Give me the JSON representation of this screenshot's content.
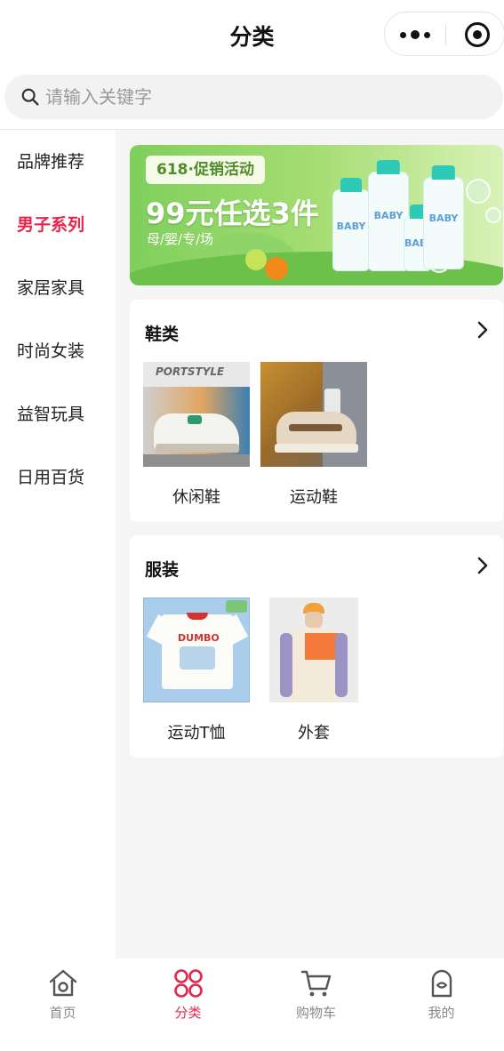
{
  "header": {
    "title": "分类"
  },
  "search": {
    "placeholder": "请输入关键字",
    "value": ""
  },
  "sidebar": {
    "items": [
      {
        "label": "品牌推荐",
        "active": false
      },
      {
        "label": "男子系列",
        "active": true
      },
      {
        "label": "家居家具",
        "active": false
      },
      {
        "label": "时尚女装",
        "active": false
      },
      {
        "label": "益智玩具",
        "active": false
      },
      {
        "label": "日用百货",
        "active": false
      }
    ]
  },
  "banner": {
    "tag": "618·促销活动",
    "headline": "99元任选3件",
    "subline": "母/婴/专/场",
    "product_labels": [
      "BABY",
      "BABY",
      "BABY",
      "BABY"
    ]
  },
  "sections": [
    {
      "title": "鞋类",
      "products": [
        {
          "label": "休闲鞋",
          "image_text": "PORTSTYLE"
        },
        {
          "label": "运动鞋"
        }
      ]
    },
    {
      "title": "服装",
      "products": [
        {
          "label": "运动T恤",
          "image_text": "DUMBO"
        },
        {
          "label": "外套"
        }
      ]
    }
  ],
  "tabbar": {
    "items": [
      {
        "label": "首页",
        "icon": "home-icon",
        "active": false
      },
      {
        "label": "分类",
        "icon": "category-icon",
        "active": true
      },
      {
        "label": "购物车",
        "icon": "cart-icon",
        "active": false
      },
      {
        "label": "我的",
        "icon": "profile-icon",
        "active": false
      }
    ]
  },
  "colors": {
    "accent": "#e5264d",
    "background": "#f5f5f5",
    "banner_green": "#7fcf5d"
  }
}
